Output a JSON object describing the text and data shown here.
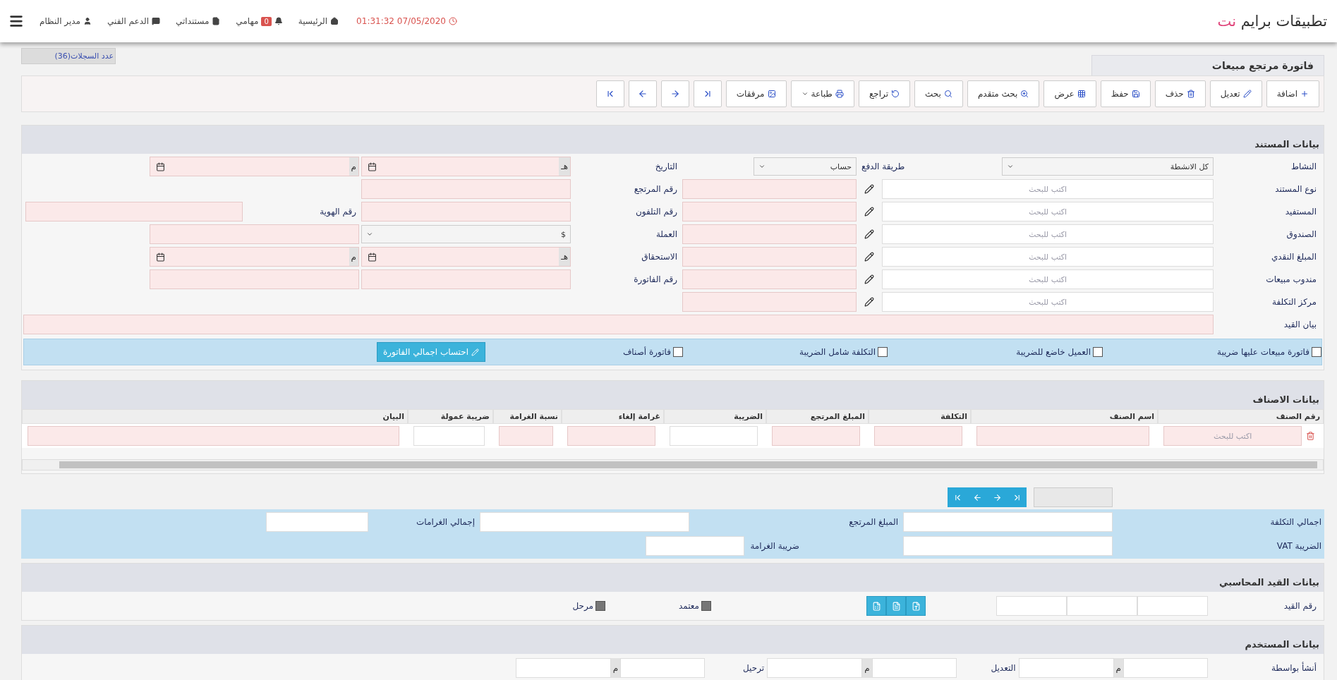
{
  "header": {
    "brand": "تطبيقات برايم",
    "brand_accent": "نت",
    "datetime": "01:31:32 07/05/2020",
    "nav": [
      {
        "label": "الرئيسية"
      },
      {
        "label": "مهامي",
        "badge": "0"
      },
      {
        "label": "مستنداتي"
      },
      {
        "label": "الدعم الفني"
      },
      {
        "label": "مدير النظام"
      }
    ]
  },
  "records_count": "عدد السجلات(36)",
  "tab": "فاتورة مرتجع مبيعات",
  "toolbar": [
    {
      "label": "اضافة"
    },
    {
      "label": "تعديل"
    },
    {
      "label": "حذف"
    },
    {
      "label": "حفظ"
    },
    {
      "label": "عرض"
    },
    {
      "label": "بحث متقدم"
    },
    {
      "label": "بحث"
    },
    {
      "label": "تراجع"
    },
    {
      "label": "طباعة",
      "dropdown": true
    },
    {
      "label": "مرفقات"
    }
  ],
  "document": {
    "title": "بيانات المستند",
    "rows": [
      {
        "kind": "select",
        "label": "النشاط",
        "value": "كل الانشطة",
        "sub_label": "طريقة الدفع",
        "sub_value": "حساب",
        "middle": {
          "kind": "date",
          "label": "التاريخ",
          "hijri": "هـ",
          "gregorian": "م"
        }
      },
      {
        "kind": "search",
        "label": "نوع المستند",
        "placeholder": "اكتب للبحث",
        "middle": {
          "kind": "text",
          "label": "رقم المرتجع"
        }
      },
      {
        "kind": "search",
        "label": "المستفيد",
        "placeholder": "اكتب للبحث",
        "middle": {
          "kind": "text",
          "label": "رقم التلفون"
        },
        "extra": {
          "kind": "labeled",
          "label": "رقم الهوية"
        }
      },
      {
        "kind": "search",
        "label": "الصندوق",
        "placeholder": "اكتب للبحث",
        "middle": {
          "kind": "select",
          "label": "العملة",
          "value": "$"
        },
        "extra": {
          "kind": "text"
        }
      },
      {
        "kind": "search",
        "label": "المبلغ النقدي",
        "placeholder": "اكتب للبحث",
        "middle": {
          "kind": "date",
          "label": "الاستحقاق",
          "hijri": "هـ",
          "gregorian": "م"
        }
      },
      {
        "kind": "search",
        "label": "مندوب مبيعات",
        "placeholder": "اكتب للبحث",
        "middle": {
          "kind": "text",
          "label": "رقم الفاتورة"
        },
        "extra": {
          "kind": "text"
        }
      },
      {
        "kind": "search",
        "label": "مركز التكلفة",
        "placeholder": "اكتب للبحث"
      },
      {
        "kind": "memo",
        "label": "بيان القيد"
      }
    ],
    "checkboxes": [
      {
        "label": "فاتورة مبيعات عليها ضريبة",
        "checked": false
      },
      {
        "label": "العميل خاضع للضريبة",
        "checked": false
      },
      {
        "label": "التكلفة شامل الضريبة",
        "checked": false
      },
      {
        "label": "فاتورة أصناف",
        "checked": false
      }
    ],
    "calc_button": "احتساب اجمالي الفاتورة"
  },
  "items": {
    "title": "بيانات الاصناف",
    "columns": [
      "رقم الصنف",
      "اسم الصنف",
      "التكلفة",
      "المبلغ المرتجع",
      "الضريبة",
      "غرامة إلغاء",
      "نسبة الغرامة",
      "ضريبة عمولة",
      "البيان"
    ],
    "row_placeholder": "اكتب للبحث"
  },
  "totals": {
    "row1": [
      {
        "label": "اجمالي التكلفة"
      },
      {
        "label": "المبلغ المرتجع"
      },
      {
        "label": "إجمالي الغرامات"
      }
    ],
    "row2": [
      {
        "label": "الضريبة VAT"
      },
      {
        "label": "ضريبة الغرامة"
      }
    ]
  },
  "accounting": {
    "title": "بيانات القيد المحاسبي",
    "entry_label": "رقم القيد",
    "flags": [
      {
        "label": "معتمد",
        "disabled": true
      },
      {
        "label": "مرحل",
        "disabled": true
      }
    ]
  },
  "user": {
    "title": "بيانات المستخدم",
    "fields": [
      {
        "label": "أنشأ بواسطة",
        "mark": "م"
      },
      {
        "label": "التعديل",
        "mark": "م"
      },
      {
        "label": "ترحيل",
        "mark": "م"
      }
    ]
  }
}
